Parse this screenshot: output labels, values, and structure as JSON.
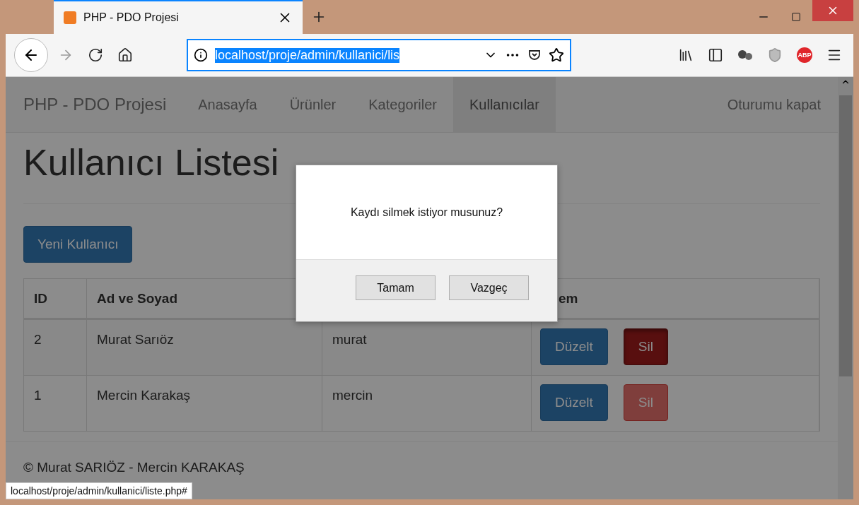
{
  "browser": {
    "tab": {
      "title": "PHP - PDO Projesi"
    },
    "url": "localhost/proje/admin/kullanici/lis",
    "adblock_label": "ABP",
    "status_url": "localhost/proje/admin/kullanici/liste.php#"
  },
  "navbar": {
    "brand": "PHP - PDO Projesi",
    "items": [
      {
        "label": "Anasayfa",
        "selected": false
      },
      {
        "label": "Ürünler",
        "selected": false
      },
      {
        "label": "Kategoriler",
        "selected": false
      },
      {
        "label": "Kullanıcılar",
        "selected": true
      }
    ],
    "logout": "Oturumu kapat"
  },
  "page": {
    "title": "Kullanıcı Listesi",
    "new_button": "Yeni Kullanıcı"
  },
  "table": {
    "columns": [
      {
        "label": "ID"
      },
      {
        "label": "Ad ve Soyad"
      },
      {},
      {
        "label": "em"
      }
    ],
    "rows": [
      {
        "id": "2",
        "name": "Murat Sarıöz",
        "username": "murat",
        "edit": "Düzelt",
        "delete": "Sil",
        "delete_pressed": true
      },
      {
        "id": "1",
        "name": "Mercin Karakaş",
        "username": "mercin",
        "edit": "Düzelt",
        "delete": "Sil",
        "delete_pressed": false
      }
    ]
  },
  "footer": "© Murat SARIÖZ - Mercin KARAKAŞ",
  "dialog": {
    "message": "Kaydı silmek istiyor musunuz?",
    "buttons": [
      "Tamam",
      "Vazgeç"
    ]
  }
}
